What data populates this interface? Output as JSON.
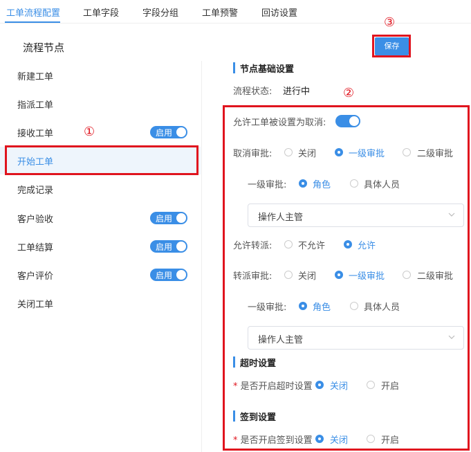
{
  "tabs": [
    {
      "label": "工单流程配置",
      "active": true
    },
    {
      "label": "工单字段"
    },
    {
      "label": "字段分组"
    },
    {
      "label": "工单预警"
    },
    {
      "label": "回访设置"
    }
  ],
  "sidebar": {
    "title": "流程节点",
    "items": [
      {
        "label": "新建工单"
      },
      {
        "label": "指派工单"
      },
      {
        "label": "接收工单",
        "toggle": "启用"
      },
      {
        "label": "开始工单",
        "active": true
      },
      {
        "label": "完成记录"
      },
      {
        "label": "客户验收",
        "toggle": "启用"
      },
      {
        "label": "工单结算",
        "toggle": "启用"
      },
      {
        "label": "客户评价",
        "toggle": "启用"
      },
      {
        "label": "关闭工单"
      }
    ]
  },
  "save_label": "保存",
  "annotations": [
    "①",
    "②",
    "③"
  ],
  "basic": {
    "title": "节点基础设置",
    "status_label": "流程状态:",
    "status_value": "进行中",
    "allow_cancel_label": "允许工单被设置为取消:",
    "cancel_approval_label": "取消审批:",
    "cancel_options": [
      "关闭",
      "一级审批",
      "二级审批"
    ],
    "cancel_level1_label": "一级审批:",
    "cancel_level1_options": [
      "角色",
      "具体人员"
    ],
    "cancel_select_value": "操作人主管",
    "transfer_label": "允许转派:",
    "transfer_options": [
      "不允许",
      "允许"
    ],
    "transfer_approval_label": "转派审批:",
    "transfer_approval_options": [
      "关闭",
      "一级审批",
      "二级审批"
    ],
    "transfer_level1_label": "一级审批:",
    "transfer_level1_options": [
      "角色",
      "具体人员"
    ],
    "transfer_select_value": "操作人主管"
  },
  "timeout": {
    "title": "超时设置",
    "label": "是否开启超时设置",
    "options": [
      "关闭",
      "开启"
    ]
  },
  "signin": {
    "title": "签到设置",
    "label": "是否开启签到设置",
    "options": [
      "关闭",
      "开启"
    ]
  },
  "colors": {
    "accent": "#3a8ee6",
    "annotation": "#e0141e"
  }
}
